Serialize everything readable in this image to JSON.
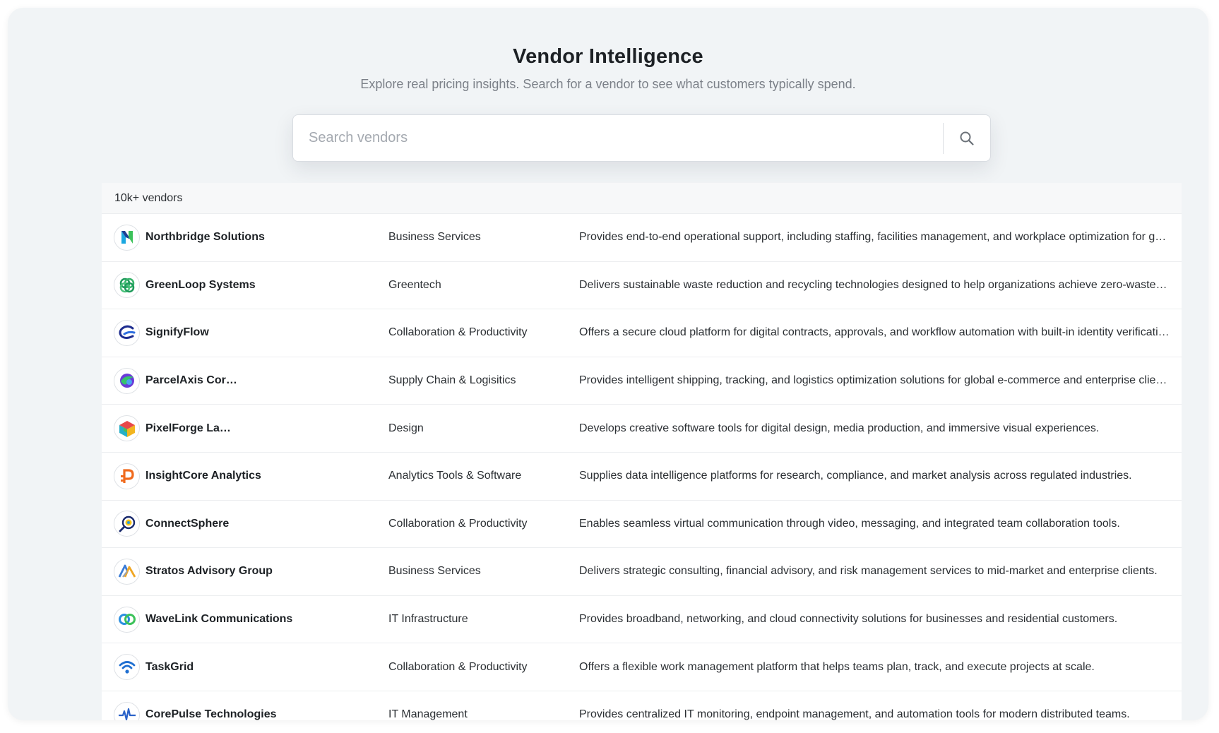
{
  "header": {
    "title": "Vendor Intelligence",
    "subtitle": "Explore real pricing insights. Search for a vendor to see what customers typically spend."
  },
  "search": {
    "placeholder": "Search vendors",
    "value": "",
    "button_icon": "search-icon"
  },
  "table": {
    "count_label": "10k+ vendors",
    "rows": [
      {
        "name": "Northbridge Solutions",
        "category": "Business Services",
        "description": "Provides end-to-end operational support, including staffing, facilities management, and workplace optimization for gro…",
        "logo_icon": "northbridge-logo-icon"
      },
      {
        "name": "GreenLoop Systems",
        "category": "Greentech",
        "description": "Delivers sustainable waste reduction and recycling technologies designed to help organizations achieve zero-waste g…",
        "logo_icon": "greenloop-logo-icon"
      },
      {
        "name": "SignifyFlow",
        "category": "Collaboration & Productivity",
        "description": "Offers a secure cloud platform for digital contracts, approvals, and workflow automation with built-in identity verificati…",
        "logo_icon": "signifyflow-logo-icon"
      },
      {
        "name": "ParcelAxis Cor…",
        "category": "Supply Chain & Logisitics",
        "description": "Provides intelligent shipping, tracking, and logistics optimization solutions for global e-commerce and enterprise clien…",
        "logo_icon": "parcelaxis-logo-icon"
      },
      {
        "name": "PixelForge La…",
        "category": "Design",
        "description": "Develops creative software tools for digital design, media production, and immersive visual experiences.",
        "logo_icon": "pixelforge-logo-icon"
      },
      {
        "name": "InsightCore Analytics",
        "category": "Analytics Tools & Software",
        "description": "Supplies data intelligence platforms for research, compliance, and market analysis across regulated industries.",
        "logo_icon": "insightcore-logo-icon"
      },
      {
        "name": "ConnectSphere",
        "category": "Collaboration & Productivity",
        "description": "Enables seamless virtual communication through video, messaging, and integrated team collaboration tools.",
        "logo_icon": "connectsphere-logo-icon"
      },
      {
        "name": "Stratos Advisory Group",
        "category": "Business Services",
        "description": "Delivers strategic consulting, financial advisory, and risk management services to mid-market and enterprise clients.",
        "logo_icon": "stratos-logo-icon"
      },
      {
        "name": "WaveLink Communications",
        "category": "IT Infrastructure",
        "description": "Provides broadband, networking, and cloud connectivity solutions for businesses and residential customers.",
        "logo_icon": "wavelink-logo-icon"
      },
      {
        "name": "TaskGrid",
        "category": "Collaboration & Productivity",
        "description": "Offers a flexible work management platform that helps teams plan, track, and execute projects at scale.",
        "logo_icon": "taskgrid-logo-icon"
      },
      {
        "name": "CorePulse Technologies",
        "category": "IT Management",
        "description": "Provides centralized IT monitoring, endpoint management, and automation tools for modern distributed teams.",
        "logo_icon": "corepulse-logo-icon"
      }
    ]
  }
}
